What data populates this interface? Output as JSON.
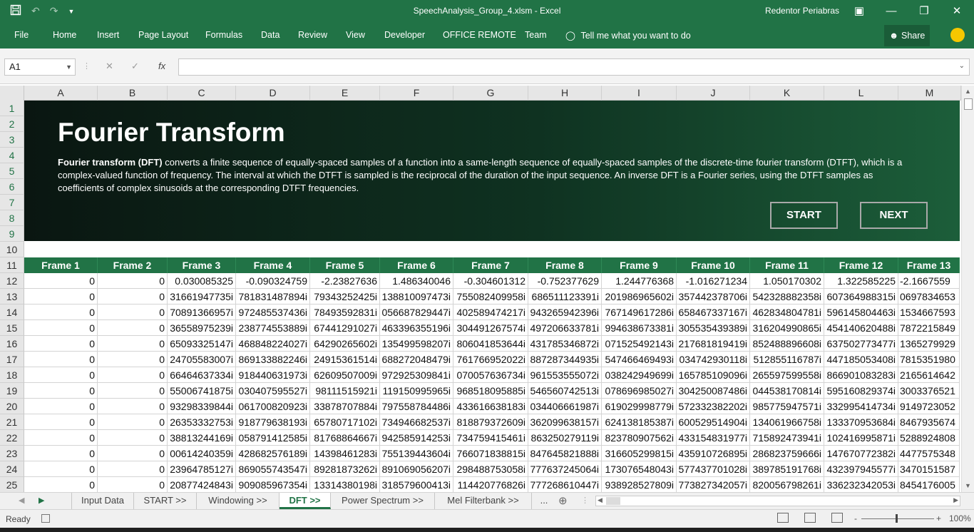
{
  "window": {
    "title": "SpeechAnalysis_Group_4.xlsm  -  Excel",
    "user": "Redentor Periabras"
  },
  "ribbon": {
    "tabs": [
      "File",
      "Home",
      "Insert",
      "Page Layout",
      "Formulas",
      "Data",
      "Review",
      "View",
      "Developer",
      "OFFICE REMOTE",
      "Team"
    ],
    "tell_me": "Tell me what you want to do",
    "share": "Share"
  },
  "formula_bar": {
    "name_box": "A1",
    "fx": "fx",
    "value": ""
  },
  "columns": [
    "A",
    "B",
    "C",
    "D",
    "E",
    "F",
    "G",
    "H",
    "I",
    "J",
    "K",
    "L",
    "M"
  ],
  "rows": [
    "1",
    "2",
    "3",
    "4",
    "5",
    "6",
    "7",
    "8",
    "9",
    "10",
    "11",
    "12",
    "13",
    "14",
    "15",
    "16",
    "17",
    "18",
    "19",
    "20",
    "21",
    "22",
    "23",
    "24",
    "25"
  ],
  "banner": {
    "title": "Fourier Transform",
    "desc_bold": "Fourier transform (DFT)",
    "desc_rest": " converts a finite sequence of equally-spaced samples of a function into a same-length sequence of equally-spaced samples of the discrete-time fourier transform (DTFT), which is a complex-valued function of frequency. The interval at which the DTFT is sampled is the reciprocal of the duration of the input sequence. An inverse DFT is a Fourier series, using the DTFT samples as coefficients of complex sinusoids at the corresponding DTFT frequencies.",
    "start_button": "START",
    "next_button": "NEXT"
  },
  "table": {
    "headers": [
      "Frame 1",
      "Frame 2",
      "Frame 3",
      "Frame 4",
      "Frame 5",
      "Frame 6",
      "Frame 7",
      "Frame 8",
      "Frame 9",
      "Frame 10",
      "Frame 11",
      "Frame 12",
      "Frame 13"
    ],
    "rows": [
      [
        "0",
        "0",
        "0.030085325",
        "-0.090324759",
        "-2.23827636",
        "1.486340046",
        "-0.304601312",
        "-0.752377629",
        "1.244776368",
        "-1.016271234",
        "1.050170302",
        "1.322585225",
        "-2.1667559"
      ],
      [
        "0",
        "0",
        "31661947735i",
        "781831487894i",
        "79343252425i",
        "138810097473i",
        "755082409958i",
        "686511123391i",
        "201986965602i",
        "357442378706i",
        "542328882358i",
        "607364988315i",
        "0697834653"
      ],
      [
        "0",
        "0",
        "70891366957i",
        "972485537436i",
        "78493592831i",
        "056687829447i",
        "402589474217i",
        "943265942396i",
        "767149617286i",
        "658467337167i",
        "462834804781i",
        "596145804463i",
        "1534667593"
      ],
      [
        "0",
        "0",
        "36558975239i",
        "238774553889i",
        "67441291027i",
        "463396355196i",
        "304491267574i",
        "497206633781i",
        "994638673381i",
        "305535439389i",
        "316204990865i",
        "454140620488i",
        "7872215849"
      ],
      [
        "0",
        "0",
        "65093325147i",
        "468848224027i",
        "64290265602i",
        "135499598207i",
        "806041853644i",
        "431785346872i",
        "071525492143i",
        "217681819419i",
        "852488896608i",
        "637502773477i",
        "1365279929"
      ],
      [
        "0",
        "0",
        "24705583007i",
        "869133882246i",
        "24915361514i",
        "688272048479i",
        "761766952022i",
        "887287344935i",
        "547466469493i",
        "034742930118i",
        "512855116787i",
        "447185053408i",
        "7815351980"
      ],
      [
        "0",
        "0",
        "66464637334i",
        "918440631973i",
        "62609507009i",
        "972925309841i",
        "070057636734i",
        "961553555072i",
        "038242949699i",
        "165785109096i",
        "265597599558i",
        "866901083283i",
        "2165614642"
      ],
      [
        "0",
        "0",
        "55006741875i",
        "030407595527i",
        "98111515921i",
        "119150995965i",
        "968518095885i",
        "546560742513i",
        "078696985027i",
        "304250087486i",
        "044538170814i",
        "595160829374i",
        "3003376521"
      ],
      [
        "0",
        "0",
        "93298339844i",
        "061700820923i",
        "33878707884i",
        "797558784486i",
        "433616638183i",
        "034406661987i",
        "619029998779i",
        "572332382202i",
        "985775947571i",
        "332995414734i",
        "9149723052"
      ],
      [
        "0",
        "0",
        "26353332753i",
        "918779638193i",
        "65780717102i",
        "734946682537i",
        "818879372609i",
        "362099638157i",
        "624138185387i",
        "600529514904i",
        "134061966758i",
        "133370953684i",
        "8467935674"
      ],
      [
        "0",
        "0",
        "38813244169i",
        "058791412585i",
        "81768864667i",
        "942585914253i",
        "734759415461i",
        "863250279119i",
        "823780907562i",
        "433154831977i",
        "715892473941i",
        "102416995871i",
        "5288924808"
      ],
      [
        "0",
        "0",
        "00614240359i",
        "428682576189i",
        "14398461283i",
        "755139443604i",
        "766071838815i",
        "847645821888i",
        "316605299815i",
        "435910726895i",
        "286823759666i",
        "147670772382i",
        "4477575348"
      ],
      [
        "0",
        "0",
        "23964785127i",
        "869055743547i",
        "89281873262i",
        "891069056207i",
        "298488753058i",
        "777637245064i",
        "173076548043i",
        "577437701028i",
        "389785191768i",
        "432397945577i",
        "3470151587"
      ],
      [
        "0",
        "0",
        "20877424843i",
        "909085967354i",
        "13314380198i",
        "318579600413i",
        "114420776826i",
        "777268610447i",
        "938928527809i",
        "773827342057i",
        "820056798261i",
        "336232342053i",
        "8454176005"
      ]
    ]
  },
  "sheet_tabs": [
    "Input Data",
    "START >>",
    "Windowing >>",
    "DFT >>",
    "Power Spectrum >>",
    "Mel Filterbank >>",
    "..."
  ],
  "active_sheet": "DFT >>",
  "status": {
    "ready": "Ready",
    "zoom": "100%",
    "minus": "-",
    "plus": "+"
  },
  "colors": {
    "excel_green": "#217346",
    "banner_dark": "#0a1611",
    "banner_light": "#1c5e3a"
  }
}
